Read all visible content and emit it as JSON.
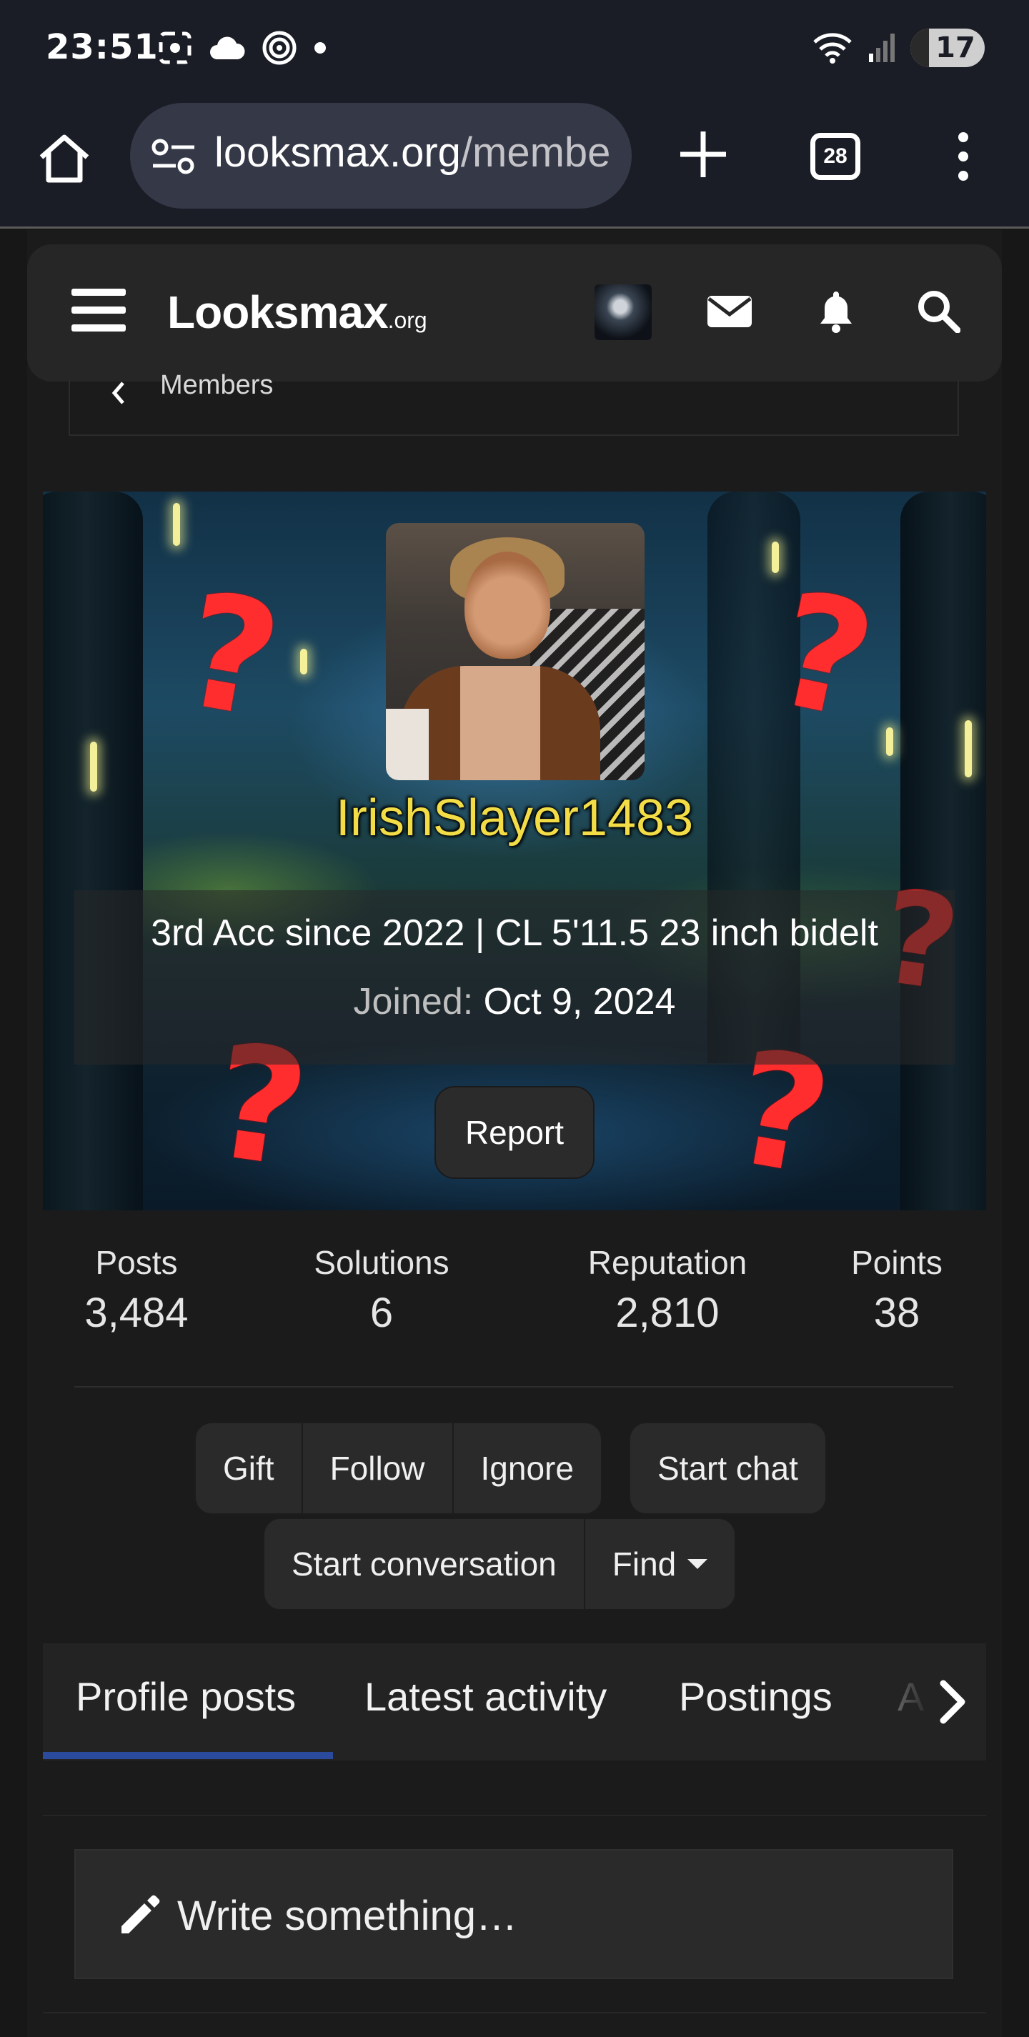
{
  "status_bar": {
    "time": "23:51",
    "icons": [
      "screenshot-icon",
      "cloud-icon",
      "hotspot-icon",
      "dot-icon"
    ],
    "right_icons": [
      "wifi-icon",
      "signal-icon"
    ],
    "battery": "17"
  },
  "browser": {
    "url_host": "looksmax.org",
    "url_path": "/membe",
    "tab_count": "28"
  },
  "site": {
    "logo_main": "Looksmax",
    "logo_suffix": ".org"
  },
  "breadcrumb": {
    "label": "Members"
  },
  "profile": {
    "username": "IrishSlayer1483",
    "custom_title": "3rd Acc since 2022 | CL 5'11.5 23 inch bidelt",
    "joined_label": "Joined:",
    "joined_date": "Oct 9, 2024",
    "report_label": "Report"
  },
  "stats": [
    {
      "label": "Posts",
      "value": "3,484"
    },
    {
      "label": "Solutions",
      "value": "6"
    },
    {
      "label": "Reputation",
      "value": "2,810"
    },
    {
      "label": "Points",
      "value": "38"
    }
  ],
  "actions": {
    "gift": "Gift",
    "follow": "Follow",
    "ignore": "Ignore",
    "start_chat": "Start chat",
    "start_conversation": "Start conversation",
    "find": "Find"
  },
  "tabs": [
    {
      "label": "Profile posts",
      "active": true
    },
    {
      "label": "Latest activity",
      "active": false
    },
    {
      "label": "Postings",
      "active": false
    },
    {
      "label": "A",
      "active": false
    }
  ],
  "composer": {
    "placeholder": "Write something…"
  },
  "colors": {
    "username": "#f2dd47",
    "active_tab": "#2c4a9c",
    "question_marks": "#ff2d2d"
  }
}
